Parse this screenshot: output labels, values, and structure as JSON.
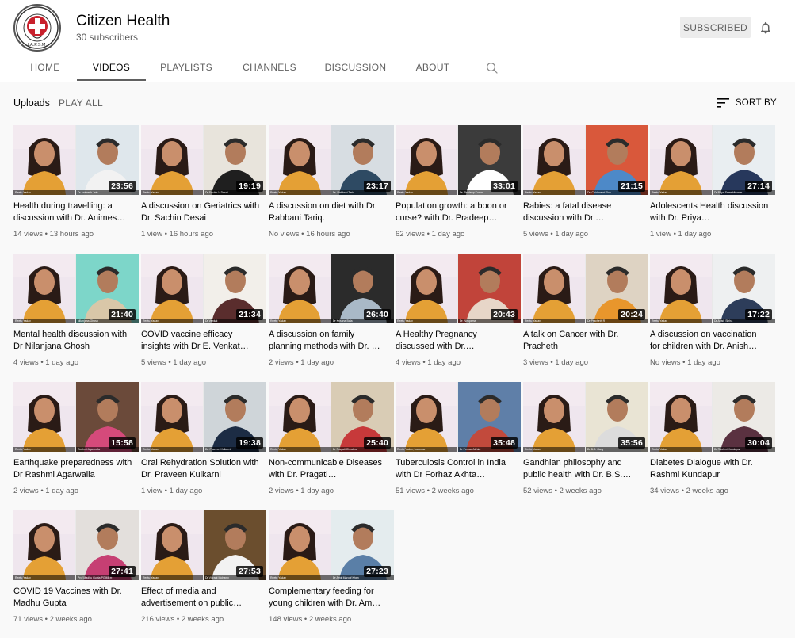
{
  "channel": {
    "name": "Citizen Health",
    "subscribers": "30 subscribers",
    "subscribe_label": "SUBSCRIBED",
    "logo_text": "I.A.P.S.M."
  },
  "tabs": [
    {
      "label": "HOME",
      "active": false
    },
    {
      "label": "VIDEOS",
      "active": true
    },
    {
      "label": "PLAYLISTS",
      "active": false
    },
    {
      "label": "CHANNELS",
      "active": false
    },
    {
      "label": "DISCUSSION",
      "active": false
    },
    {
      "label": "ABOUT",
      "active": false
    }
  ],
  "uploads": {
    "label": "Uploads",
    "play_all": "PLAY ALL",
    "sort_by": "SORT BY"
  },
  "colors": {
    "host_top": "#efe6ee",
    "host_shirt": "#e4a035",
    "guest_bg": "#c9d8e6"
  },
  "videos": [
    {
      "title": "Health during travelling: a discussion with Dr. Animes…",
      "views": "14 views",
      "age": "13 hours ago",
      "duration": "23:56",
      "host_tag": "Reetu Yadav",
      "guest_tag": "Dr Animesh Jain",
      "guest_bg": "#dfe7ec",
      "guest_shirt": "#f2f2f2"
    },
    {
      "title": "A discussion on Geriatrics with Dr. Sachin Desai",
      "views": "1 view",
      "age": "16 hours ago",
      "duration": "19:19",
      "host_tag": "Reetu Yadav",
      "guest_tag": "Dr Sachin V Desai",
      "guest_bg": "#e8e4dc",
      "guest_shirt": "#1f1f1f"
    },
    {
      "title": "A discussion on diet with Dr. Rabbani Tariq.",
      "views": "No views",
      "age": "16 hours ago",
      "duration": "23:17",
      "host_tag": "Reetu Yadav",
      "guest_tag": "Dr. Rabbani Tariq",
      "guest_bg": "#d7dde2",
      "guest_shirt": "#2e4a63"
    },
    {
      "title": "Population growth: a boon or curse? with Dr. Pradeep…",
      "views": "62 views",
      "age": "1 day ago",
      "duration": "33:01",
      "host_tag": "Reetu Yadav",
      "guest_tag": "Dr. Pradeep Kumar",
      "guest_bg": "#3b3b3b",
      "guest_shirt": "#ffffff"
    },
    {
      "title": "Rabies: a fatal disease discussion with Dr.…",
      "views": "5 views",
      "age": "1 day ago",
      "duration": "21:15",
      "host_tag": "Reetu Yadav",
      "guest_tag": "Dr. Chidanand Roy",
      "guest_bg": "#d9583b",
      "guest_shirt": "#4d89c8"
    },
    {
      "title": "Adolescents Health discussion with Dr. Priya…",
      "views": "1 view",
      "age": "1 day ago",
      "duration": "27:14",
      "host_tag": "Reetu Yadav",
      "guest_tag": "Dr Priya Sreeshikumar",
      "guest_bg": "#e9eef1",
      "guest_shirt": "#27385c"
    },
    {
      "title": "Mental health discussion with Dr Nilanjana Ghosh",
      "views": "4 views",
      "age": "1 day ago",
      "duration": "21:40",
      "host_tag": "Reetu Yadav",
      "guest_tag": "Nilanjana Ghosh",
      "guest_bg": "#7dd6c9",
      "guest_shirt": "#d9c7a8"
    },
    {
      "title": "COVID vaccine efficacy insights with Dr E. Venkat…",
      "views": "5 views",
      "age": "1 day ago",
      "duration": "21:34",
      "host_tag": "Reetu Yadav",
      "guest_tag": "Dr Venkat",
      "guest_bg": "#f2efea",
      "guest_shirt": "#5a2d2d"
    },
    {
      "title": "A discussion on family planning methods with Dr. …",
      "views": "2 views",
      "age": "1 day ago",
      "duration": "26:40",
      "host_tag": "Reetu Yadav",
      "guest_tag": "Dr Krishna Bala",
      "guest_bg": "#2b2b2b",
      "guest_shirt": "#a9b9c7"
    },
    {
      "title": "A Healthy Pregnancy discussed with Dr.…",
      "views": "4 views",
      "age": "1 day ago",
      "duration": "20:43",
      "host_tag": "Reetu Yadav",
      "guest_tag": "Dr. Nirupama",
      "guest_bg": "#c1443a",
      "guest_shirt": "#e7d6c8"
    },
    {
      "title": "A talk on Cancer with Dr. Pracheth",
      "views": "3 views",
      "age": "1 day ago",
      "duration": "20:24",
      "host_tag": "Reetu Yadav",
      "guest_tag": "Dr Pracheth R",
      "guest_bg": "#ded3c3",
      "guest_shirt": "#e8962c"
    },
    {
      "title": "A discussion on vaccination for children with Dr. Anish…",
      "views": "No views",
      "age": "1 day ago",
      "duration": "17:22",
      "host_tag": "Reetu Yadav",
      "guest_tag": "Dr Anish Sinha",
      "guest_bg": "#eef0f1",
      "guest_shirt": "#2d3d5a"
    },
    {
      "title": "Earthquake preparedness with Dr Rashmi Agarwalla",
      "views": "2 views",
      "age": "1 day ago",
      "duration": "15:58",
      "host_tag": "Reetu Yadav",
      "guest_tag": "Rashmi Agarwalla",
      "guest_bg": "#6b4a3a",
      "guest_shirt": "#d54a7b"
    },
    {
      "title": "Oral Rehydration Solution with Dr. Praveen Kulkarni",
      "views": "1 view",
      "age": "1 day ago",
      "duration": "19:38",
      "host_tag": "Reetu Yadav",
      "guest_tag": "Dr. Praveen Kulkarni",
      "guest_bg": "#cfd5d9",
      "guest_shirt": "#1c2c44"
    },
    {
      "title": "Non-communicable Diseases with Dr. Pragati…",
      "views": "2 views",
      "age": "1 day ago",
      "duration": "25:40",
      "host_tag": "Reetu Yadav",
      "guest_tag": "Dr Pragati Chhabra",
      "guest_bg": "#d9ccb5",
      "guest_shirt": "#c7393a"
    },
    {
      "title": "Tuberculosis Control in India with Dr Forhaz Akhta…",
      "views": "51 views",
      "age": "2 weeks ago",
      "duration": "35:48",
      "host_tag": "Reetu Yadav, Lucknow",
      "guest_tag": "Dr Forhad Akhtar",
      "guest_bg": "#5f7fa8",
      "guest_shirt": "#c24a3c"
    },
    {
      "title": "Gandhian philosophy and public health with Dr. B.S.…",
      "views": "52 views",
      "age": "2 weeks ago",
      "duration": "35:56",
      "host_tag": "Reetu Yadav",
      "guest_tag": "Dr B.S. Garg",
      "guest_bg": "#e9e4d4",
      "guest_shirt": "#dcdcdc"
    },
    {
      "title": "Diabetes Dialogue with Dr. Rashmi Kundapur",
      "views": "34 views",
      "age": "2 weeks ago",
      "duration": "30:04",
      "host_tag": "Reetu Yadav",
      "guest_tag": "Dr Rashmi Kundapur",
      "guest_bg": "#eceae6",
      "guest_shirt": "#5a3140"
    },
    {
      "title": "COVID 19 Vaccines with Dr. Madhu Gupta",
      "views": "71 views",
      "age": "2 weeks ago",
      "duration": "27:41",
      "host_tag": "Reetu Yadav",
      "guest_tag": "Prof Madhu Gupta PGIMER",
      "guest_bg": "#e3dfdc",
      "guest_shirt": "#c63f73"
    },
    {
      "title": "Effect of media and advertisement on public…",
      "views": "216 views",
      "age": "2 weeks ago",
      "duration": "27:53",
      "host_tag": "Reetu Yadav",
      "guest_tag": "Dr Vikrant Mohanty",
      "guest_bg": "#6b4e2e",
      "guest_shirt": "#f2f2f2"
    },
    {
      "title": "Complementary feeding for young children with Dr. Am…",
      "views": "148 views",
      "age": "2 weeks ago",
      "duration": "27:23",
      "host_tag": "Reetu Yadav",
      "guest_tag": "Dr Amir Maroof Khan",
      "guest_bg": "#e4ecee",
      "guest_shirt": "#5a7fa7"
    }
  ]
}
